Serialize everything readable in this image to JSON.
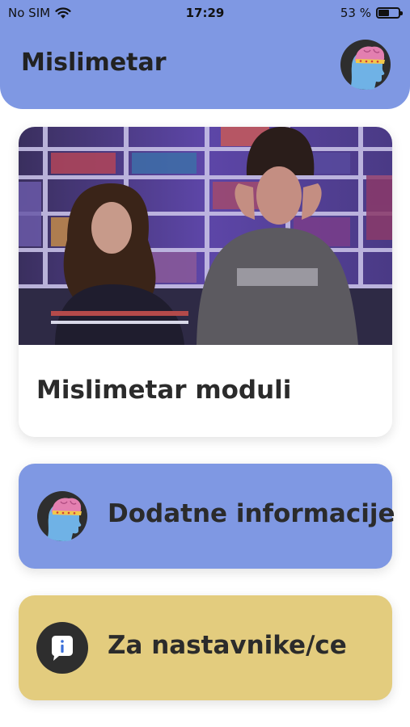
{
  "status_bar": {
    "carrier": "No SIM",
    "time": "17:29",
    "battery_percent": "53 %",
    "battery_level": 0.53,
    "wifi_icon": "wifi-icon"
  },
  "header": {
    "title": "Mislimetar",
    "avatar_icon": "brain-head-icon",
    "color": "#7f98e3"
  },
  "video_card": {
    "title": "Mislimetar moduli",
    "thumbnail": "two-women-video-thumbnail"
  },
  "cards": {
    "info": {
      "label": "Dodatne informacije",
      "icon": "brain-head-icon",
      "color": "#7f98e3"
    },
    "teachers": {
      "label": "Za nastavnike/ce",
      "icon": "info-bubble-icon",
      "color": "#e3cc7e"
    }
  }
}
